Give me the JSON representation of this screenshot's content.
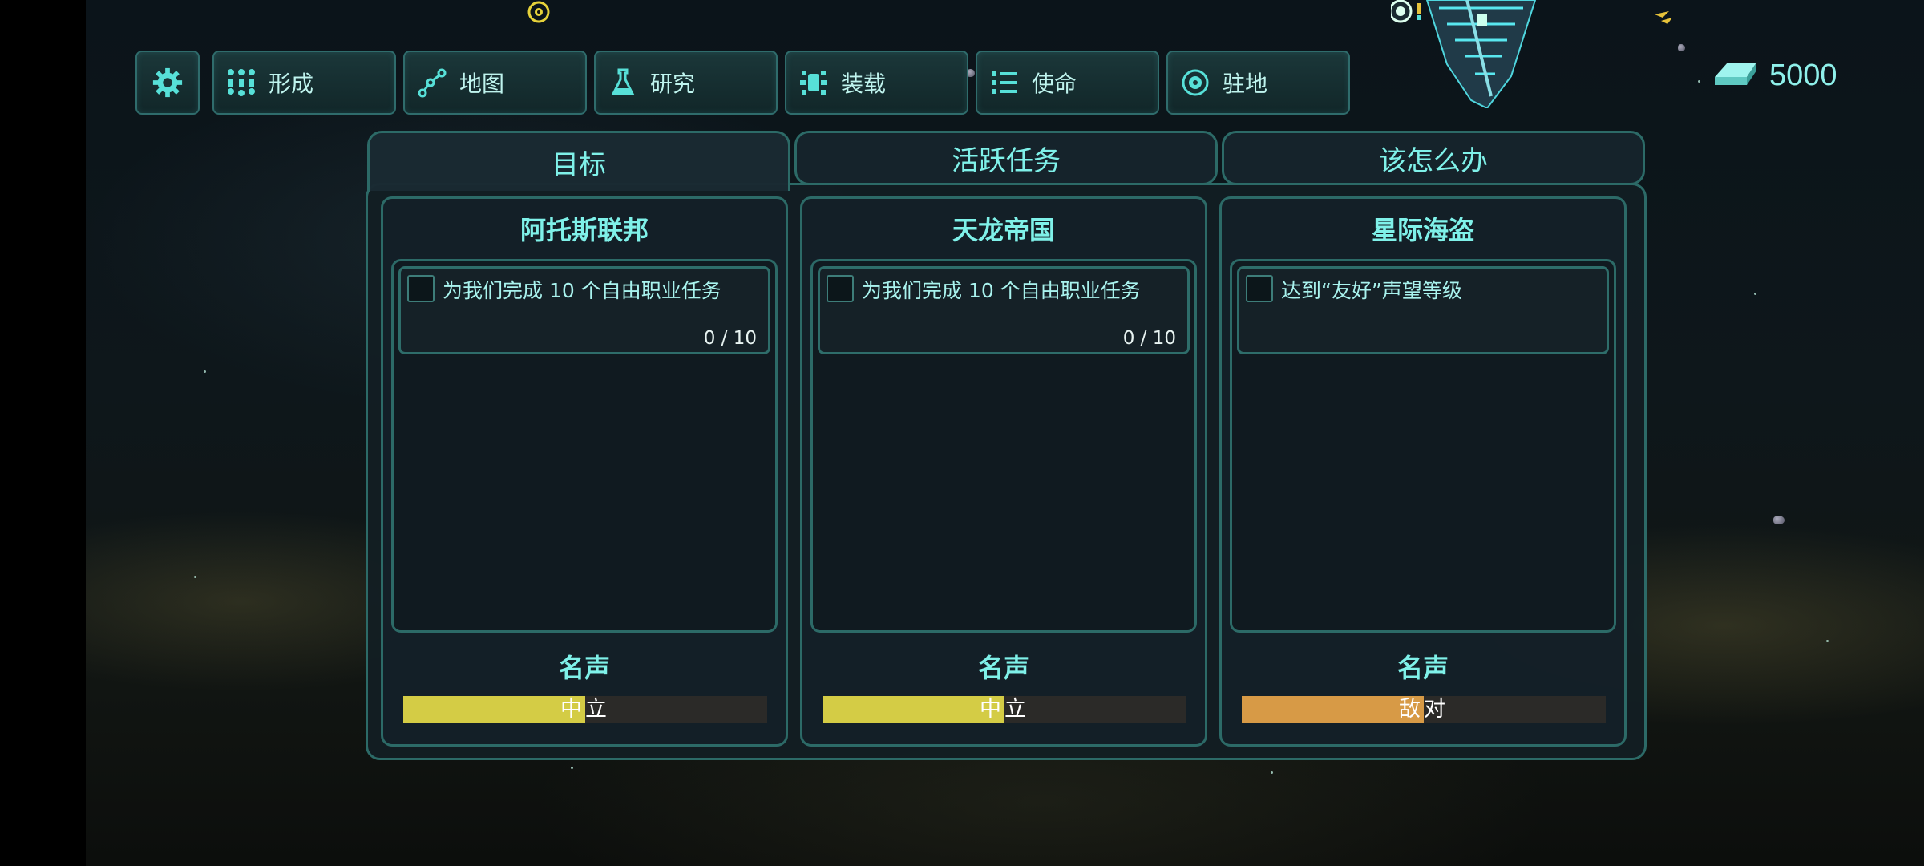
{
  "nav": {
    "settings_icon": "gear-icon",
    "buttons": [
      {
        "label": "形成",
        "icon": "formation-icon"
      },
      {
        "label": "地图",
        "icon": "map-nodes-icon"
      },
      {
        "label": "研究",
        "icon": "flask-icon"
      },
      {
        "label": "装载",
        "icon": "loadout-icon"
      },
      {
        "label": "使命",
        "icon": "list-icon"
      },
      {
        "label": "驻地",
        "icon": "base-gear-icon"
      }
    ]
  },
  "currency": {
    "icon": "ingot-icon",
    "value": "5000"
  },
  "tabs": [
    {
      "label": "目标",
      "active": true
    },
    {
      "label": "活跃任务",
      "active": false
    },
    {
      "label": "该怎么办",
      "active": false
    }
  ],
  "factions": [
    {
      "name": "阿托斯联邦",
      "tasks": [
        {
          "text": "为我们完成 10 个自由职业任务",
          "progress": "0 / 10",
          "done": false
        }
      ],
      "reputation_label": "名声",
      "reputation_status": "中立",
      "reputation_fraction": 0.5,
      "reputation_color": "#d4cc45"
    },
    {
      "name": "天龙帝国",
      "tasks": [
        {
          "text": "为我们完成 10 个自由职业任务",
          "progress": "0 / 10",
          "done": false
        }
      ],
      "reputation_label": "名声",
      "reputation_status": "中立",
      "reputation_fraction": 0.5,
      "reputation_color": "#d4cc45"
    },
    {
      "name": "星际海盗",
      "tasks": [
        {
          "text": "达到“友好”声望等级",
          "progress": "",
          "done": false
        }
      ],
      "reputation_label": "名声",
      "reputation_status": "敌对",
      "reputation_fraction": 0.5,
      "reputation_color": "#d79a46"
    }
  ],
  "colors": {
    "accent": "#7ff1e9",
    "border": "#2c6a67",
    "neutral": "#d4cc45",
    "hostile": "#d79a46"
  }
}
